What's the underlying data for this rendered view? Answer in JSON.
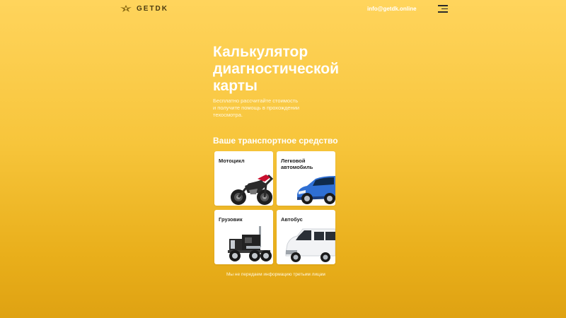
{
  "header": {
    "logo_text": "GETDK",
    "email": "info@getdk.online"
  },
  "hero": {
    "title_lines": [
      "Калькулятор",
      "диагностической",
      "карты"
    ],
    "subtitle_lines": [
      "Бесплатно рассчитайте стоимость",
      "и получите помощь в прохождении",
      "техосмотра."
    ]
  },
  "vehicles": {
    "heading": "Ваше транспортное средство",
    "items": [
      {
        "label": "Мотоцикл",
        "icon": "motorcycle-icon"
      },
      {
        "label": "Легковой автомобиль",
        "icon": "car-icon"
      },
      {
        "label": "Грузовик",
        "icon": "truck-icon"
      },
      {
        "label": "Автобус",
        "icon": "bus-icon"
      }
    ]
  },
  "footer": {
    "privacy_note": "Мы не передаем информацию третьим лицам"
  },
  "colors": {
    "bg_top": "#FFD45C",
    "bg_bottom": "#DFA212",
    "card": "#FFFFFF",
    "car": "#2F6FD3"
  }
}
